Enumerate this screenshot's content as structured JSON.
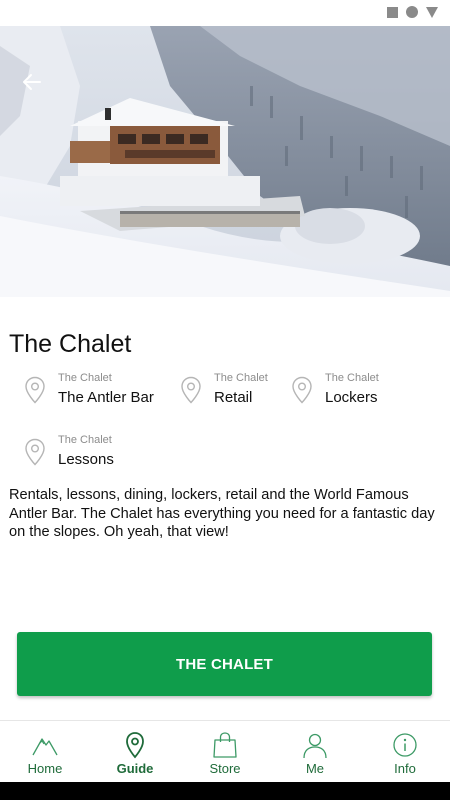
{
  "title": "The Chalet",
  "locations": [
    {
      "sub": "The Chalet",
      "name": "The Antler Bar"
    },
    {
      "sub": "The Chalet",
      "name": "Retail"
    },
    {
      "sub": "The Chalet",
      "name": "Lockers"
    },
    {
      "sub": "The Chalet",
      "name": "Lessons"
    }
  ],
  "description": "Rentals, lessons, dining, lockers, retail and the World Famous Antler Bar. The Chalet has everything you need for  a fantastic day on the slopes. Oh yeah, that view!",
  "cta_label": "THE CHALET",
  "tabs": [
    {
      "label": "Home",
      "icon": "mountain-icon"
    },
    {
      "label": "Guide",
      "icon": "map-pin-icon"
    },
    {
      "label": "Store",
      "icon": "shopping-bag-icon"
    },
    {
      "label": "Me",
      "icon": "person-icon"
    },
    {
      "label": "Info",
      "icon": "info-icon"
    }
  ],
  "colors": {
    "accent": "#0f9d4b",
    "tab_text": "#1f6b3a",
    "pin_gray": "#b5b5b5"
  }
}
